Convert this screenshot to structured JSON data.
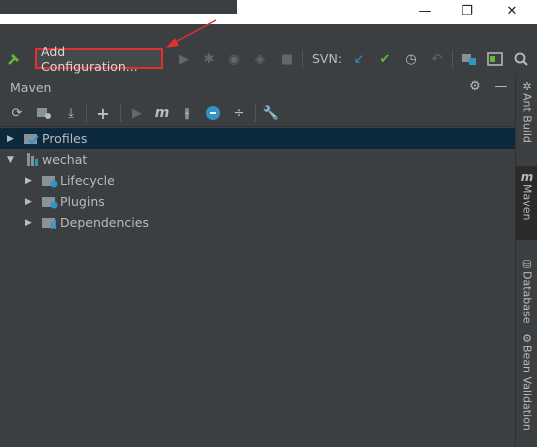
{
  "toolbar": {
    "add_config_label": "Add Configuration...",
    "svn_label": "SVN:"
  },
  "panel": {
    "title": "Maven"
  },
  "tree": {
    "items": [
      {
        "label": "Profiles",
        "level": 0,
        "selected": true
      },
      {
        "label": "wechat",
        "level": 0,
        "expanded": true
      },
      {
        "label": "Lifecycle",
        "level": 1
      },
      {
        "label": "Plugins",
        "level": 1
      },
      {
        "label": "Dependencies",
        "level": 1
      }
    ]
  },
  "right_strip": {
    "tabs": [
      {
        "label": "Ant Build",
        "icon": "ant-icon"
      },
      {
        "label": "Maven",
        "icon": "maven-icon",
        "active": true
      },
      {
        "label": "Database",
        "icon": "database-icon"
      },
      {
        "label": "Bean Validation",
        "icon": "bean-validation-icon"
      }
    ]
  },
  "colors": {
    "background": "#3c3f41",
    "selected_row": "#0d293e",
    "highlight_border": "#e03030",
    "run_green": "#499c54",
    "svn_blue": "#3592c4"
  }
}
